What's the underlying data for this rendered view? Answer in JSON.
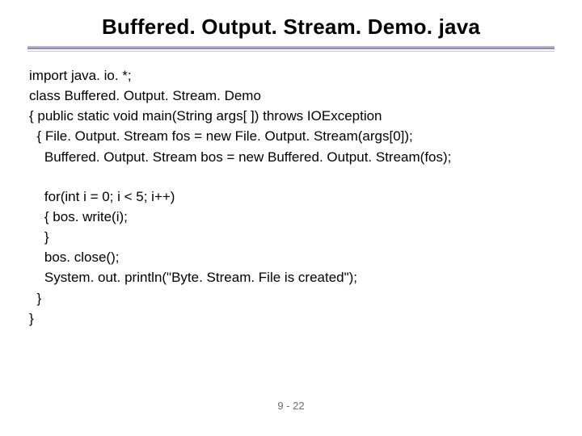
{
  "title": "Buffered. Output. Stream. Demo. java",
  "code": {
    "l1": "import java. io. *;",
    "l2": "class Buffered. Output. Stream. Demo",
    "l3": "{ public static void main(String args[ ]) throws IOException",
    "l4": "  { File. Output. Stream fos = new File. Output. Stream(args[0]);",
    "l5": "    Buffered. Output. Stream bos = new Buffered. Output. Stream(fos);",
    "l6": "    for(int i = 0; i < 5; i++)",
    "l7": "    { bos. write(i);",
    "l8": "    }",
    "l9": "    bos. close();",
    "l10": "    System. out. println(\"Byte. Stream. File is created\");",
    "l11": "  }",
    "l12": "}"
  },
  "page_number": "9 - 22"
}
